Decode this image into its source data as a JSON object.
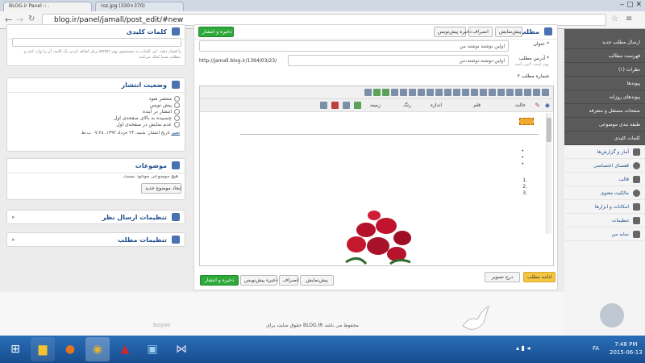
{
  "browser": {
    "tabs": [
      {
        "label": "BLOG.ir Panel :: ."
      },
      {
        "label": "roz.jpg (330×370)"
      }
    ],
    "url": "blog.ir/panel/jamall/post_edit/#new"
  },
  "left_col": {
    "keywords": {
      "title": "کلمات کلیدی",
      "help": "برای اضافه کردن یک کلمه، آن را وارد کنید و enter را فشار دهید. این کلمات به جستجوی بهتر مطلب شما کمک می‌کنند."
    },
    "publish": {
      "title": "وضعیت انتشار",
      "options": [
        "منتشر شود",
        "پیش نویس",
        "انتشار در آینده",
        "چسبیده به بالای صفحه‌ی اول",
        "عدم نمایش در صفحه‌ی اول"
      ],
      "date_label": "تاریخ انتشار: شنبه، ۲۳ خرداد ۱۳۹۴، ۰۷:۲۸ ب.ظ",
      "change_link": "تغییر"
    },
    "topics": {
      "title": "موضوعات",
      "empty": "هیچ موضوعی موجود نیست",
      "create_btn": "ایجاد موضوع جدید"
    },
    "comments": {
      "title": "تنظیمات ارسال نظر"
    },
    "post_settings": {
      "title": "تنظیمات مطلب"
    }
  },
  "editor": {
    "post_box_title": "مطلب",
    "top_buttons": {
      "preview": "پیش‌نمایش",
      "cancel": "انصراف",
      "draft": "ذخیره پیش‌نویس",
      "publish": "ذخیره و انتشار"
    },
    "title_label": "عنوان",
    "title_value": "اولین نوشته نوشته من",
    "address_label": "آدرس مطلب",
    "address_prefix": "http://jamall.blog.ir/1394/03/23/",
    "address_value": "اولین-نوشته-نوشته-من",
    "address_hint": "بهتر است لاتین باشد",
    "post_number": "شماره مطلب ۲",
    "toolbar_row2": [
      "حالت",
      "قلم",
      "اندازه",
      "رنگ",
      "زمینه"
    ],
    "list_bullets": [
      "•",
      "•",
      "•"
    ],
    "list_numbers": [
      "1.",
      "2.",
      "3."
    ],
    "bottom_buttons": {
      "continue": "ادامه مطلب",
      "insert_image": "درج تصویر"
    },
    "footer_buttons": {
      "preview": "پیش‌نمایش",
      "cancel": "انصراف",
      "draft": "ذخیره پیش‌نویس",
      "publish": "ذخیره و انتشار"
    }
  },
  "sidebar": {
    "dark_items": [
      "ارسال مطلب جدید",
      "فهرست مطالب",
      "نظرات (۱)",
      "پیوندها",
      "پیوندهای روزانه",
      "صفحات مستقل و متفرقه",
      "طبقه بندی موضوعی",
      "کلمات کلیدی"
    ],
    "light_items": [
      {
        "label": "آمار و گزارش‌ها",
        "icon": "bar-chart-icon"
      },
      {
        "label": "قفسای اختصاصی",
        "icon": "gear-icon"
      },
      {
        "label": "قالب",
        "icon": "puzzle-icon"
      },
      {
        "label": "مالکیت معنوی",
        "icon": "copyright-icon"
      },
      {
        "label": "امکانات و ابزارها",
        "icon": "tools-icon"
      },
      {
        "label": "تنظیمات",
        "icon": "wrench-icon"
      },
      {
        "label": "نمایه من",
        "icon": "profile-icon"
      }
    ]
  },
  "footer": {
    "copyright": "حقوق سایت برای BLOG.IR محفوظ می باشد",
    "logo": "boyan"
  },
  "taskbar": {
    "time": "7:48 PM",
    "date": "2015-06-13",
    "lang": "FA"
  },
  "colors": {
    "accent": "#1f4e8c",
    "green": "#2faa3a",
    "sidebar_dark": "#5a5a5a",
    "taskbar": "#1f5fa8"
  }
}
